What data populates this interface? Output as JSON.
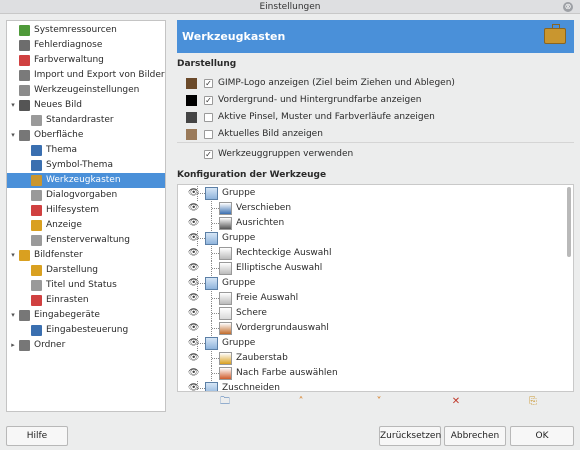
{
  "window": {
    "title": "Einstellungen",
    "close_glyph": "⊗"
  },
  "sidebar": {
    "items": [
      {
        "label": "Systemressourcen",
        "icon": "system-resources-icon",
        "color": "#4f9a3a"
      },
      {
        "label": "Fehlerdiagnose",
        "icon": "debug-icon",
        "color": "#6d6d6d"
      },
      {
        "label": "Farbverwaltung",
        "icon": "color-management-icon",
        "color": "#d04040"
      },
      {
        "label": "Import und Export von Bildern",
        "icon": "import-export-icon",
        "color": "#7a7a7a"
      },
      {
        "label": "Werkzeugeinstellungen",
        "icon": "tool-options-icon",
        "color": "#8c8c8c"
      },
      {
        "label": "Neues Bild",
        "icon": "new-image-icon",
        "color": "#555555",
        "arrow": "▾"
      },
      {
        "label": "Standardraster",
        "icon": "grid-icon",
        "color": "#9a9a9a"
      },
      {
        "label": "Oberfläche",
        "icon": "interface-icon",
        "color": "#777777",
        "arrow": "▾"
      },
      {
        "label": "Thema",
        "icon": "theme-icon",
        "color": "#3a6fb0"
      },
      {
        "label": "Symbol-Thema",
        "icon": "icon-theme-icon",
        "color": "#3a6fb0"
      },
      {
        "label": "Werkzeugkasten",
        "icon": "toolbox-icon",
        "color": "#c9962f"
      },
      {
        "label": "Dialogvorgaben",
        "icon": "dialog-defaults-icon",
        "color": "#9a9a9a"
      },
      {
        "label": "Hilfesystem",
        "icon": "help-system-icon",
        "color": "#d04040"
      },
      {
        "label": "Anzeige",
        "icon": "display-icon",
        "color": "#d9a020"
      },
      {
        "label": "Fensterverwaltung",
        "icon": "window-management-icon",
        "color": "#9a9a9a"
      },
      {
        "label": "Bildfenster",
        "icon": "image-window-icon",
        "color": "#d9a020",
        "arrow": "▾"
      },
      {
        "label": "Darstellung",
        "icon": "appearance-icon",
        "color": "#d9a020"
      },
      {
        "label": "Titel und Status",
        "icon": "title-status-icon",
        "color": "#9a9a9a"
      },
      {
        "label": "Einrasten",
        "icon": "snapping-icon",
        "color": "#d04040"
      },
      {
        "label": "Eingabegeräte",
        "icon": "input-devices-icon",
        "color": "#777777",
        "arrow": "▾"
      },
      {
        "label": "Eingabesteuerung",
        "icon": "input-controllers-icon",
        "color": "#3a6fb0"
      },
      {
        "label": "Ordner",
        "icon": "folders-icon",
        "color": "#777777",
        "arrow": "▸"
      }
    ],
    "selected_index": 10
  },
  "main": {
    "title": "Werkzeugkasten",
    "header_icon": "toolbox-icon",
    "appearance": {
      "heading": "Darstellung",
      "options": [
        {
          "label": "GIMP-Logo anzeigen (Ziel beim Ziehen und Ablegen)",
          "checked": true,
          "icon": "wilber-icon"
        },
        {
          "label": "Vordergrund- und Hintergrundfarbe anzeigen",
          "checked": true,
          "icon": "fg-bg-color-icon"
        },
        {
          "label": "Aktive Pinsel, Muster und Farbverläufe anzeigen",
          "checked": false,
          "icon": "brush-icon"
        },
        {
          "label": "Aktuelles Bild anzeigen",
          "checked": false,
          "icon": "image-icon"
        }
      ],
      "groups_option": {
        "label": "Werkzeuggruppen verwenden",
        "checked": true
      }
    },
    "tools": {
      "heading": "Konfiguration der Werkzeuge",
      "rows": [
        {
          "label": "Gruppe",
          "group": true,
          "icon": "group-icon"
        },
        {
          "label": "Verschieben",
          "group": false,
          "icon": "move-tool-icon"
        },
        {
          "label": "Ausrichten",
          "group": false,
          "icon": "align-tool-icon"
        },
        {
          "label": "Gruppe",
          "group": true,
          "icon": "group-icon"
        },
        {
          "label": "Rechteckige Auswahl",
          "group": false,
          "icon": "rect-select-icon"
        },
        {
          "label": "Elliptische Auswahl",
          "group": false,
          "icon": "ellipse-select-icon"
        },
        {
          "label": "Gruppe",
          "group": true,
          "icon": "group-icon"
        },
        {
          "label": "Freie Auswahl",
          "group": false,
          "icon": "free-select-icon"
        },
        {
          "label": "Schere",
          "group": false,
          "icon": "scissors-icon"
        },
        {
          "label": "Vordergrundauswahl",
          "group": false,
          "icon": "foreground-select-icon"
        },
        {
          "label": "Gruppe",
          "group": true,
          "icon": "group-icon"
        },
        {
          "label": "Zauberstab",
          "group": false,
          "icon": "fuzzy-select-icon"
        },
        {
          "label": "Nach Farbe auswählen",
          "group": false,
          "icon": "select-by-color-icon"
        },
        {
          "label": "Zuschneiden",
          "group": true,
          "icon": "crop-icon"
        }
      ],
      "eye_glyph": "👁",
      "toolbar": {
        "new_group": "🗀",
        "raise": "˄",
        "lower": "˅",
        "delete": "✕",
        "reset": "⎘"
      }
    }
  },
  "buttons": {
    "help": "Hilfe",
    "reset": "Zurücksetzen",
    "cancel": "Abbrechen",
    "ok": "OK"
  },
  "colors": {
    "accent": "#4a90d9",
    "delete": "#c0392b",
    "arrows": "#d98a3a"
  }
}
